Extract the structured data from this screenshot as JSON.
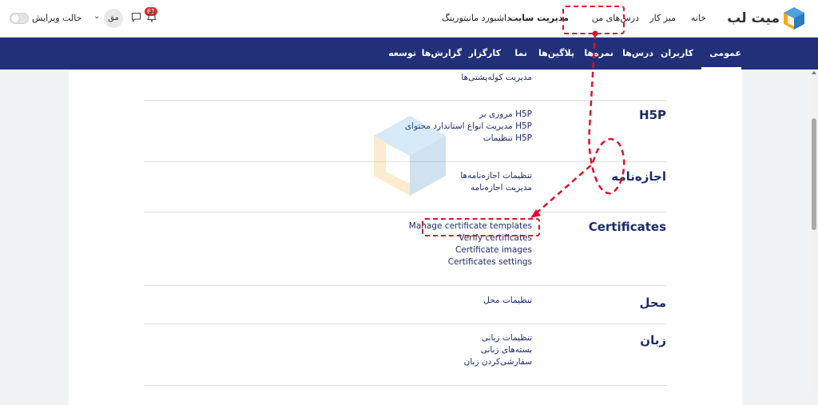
{
  "topbar": {
    "logo_text": "میت لب",
    "nav": {
      "home": "خانه",
      "dashboard": "میز کار",
      "my_courses": "درس‌های من",
      "site_admin": "مدیریت سایت",
      "monitoring": "داشبورد مانیتورینگ"
    },
    "edit_mode_label": "حالت ویرایش",
    "avatar_initials": "مق",
    "notification_count": "61"
  },
  "subnav": {
    "tabs": [
      "عمومی",
      "کاربران",
      "درس‌ها",
      "نمره‌ها",
      "پلاگین‌ها",
      "نما",
      "کارگزار",
      "گزارش‌ها",
      "توسعه"
    ],
    "active_tab": "عمومی"
  },
  "content": {
    "top_link": "مدیریت کوله‌پشتی‌ها",
    "sections": [
      {
        "title": "H5P",
        "links": [
          "مروری بر H5P",
          "مدیریت انواع استاندارد محتوای H5P",
          "تنظیمات H5P"
        ]
      },
      {
        "title": "اجازه‌نامه",
        "links": [
          "تنظیمات اجازه‌نامه‌ها",
          "مدیریت اجازه‌نامه"
        ]
      },
      {
        "title": "Certificates",
        "links": [
          "Manage certificate templates",
          "Verify certificates",
          "Certificate images",
          "Certificates settings"
        ]
      },
      {
        "title": "محل",
        "links": [
          "تنظیمات محل"
        ]
      },
      {
        "title": "زبان",
        "links": [
          "تنظیمات زبانی",
          "بسته‌های زبانی",
          "سفارشی‌کردن زبان"
        ]
      }
    ]
  },
  "colors": {
    "subnav_bg": "#22307a",
    "link": "#1d2b6b",
    "annotation": "#e0102a"
  }
}
